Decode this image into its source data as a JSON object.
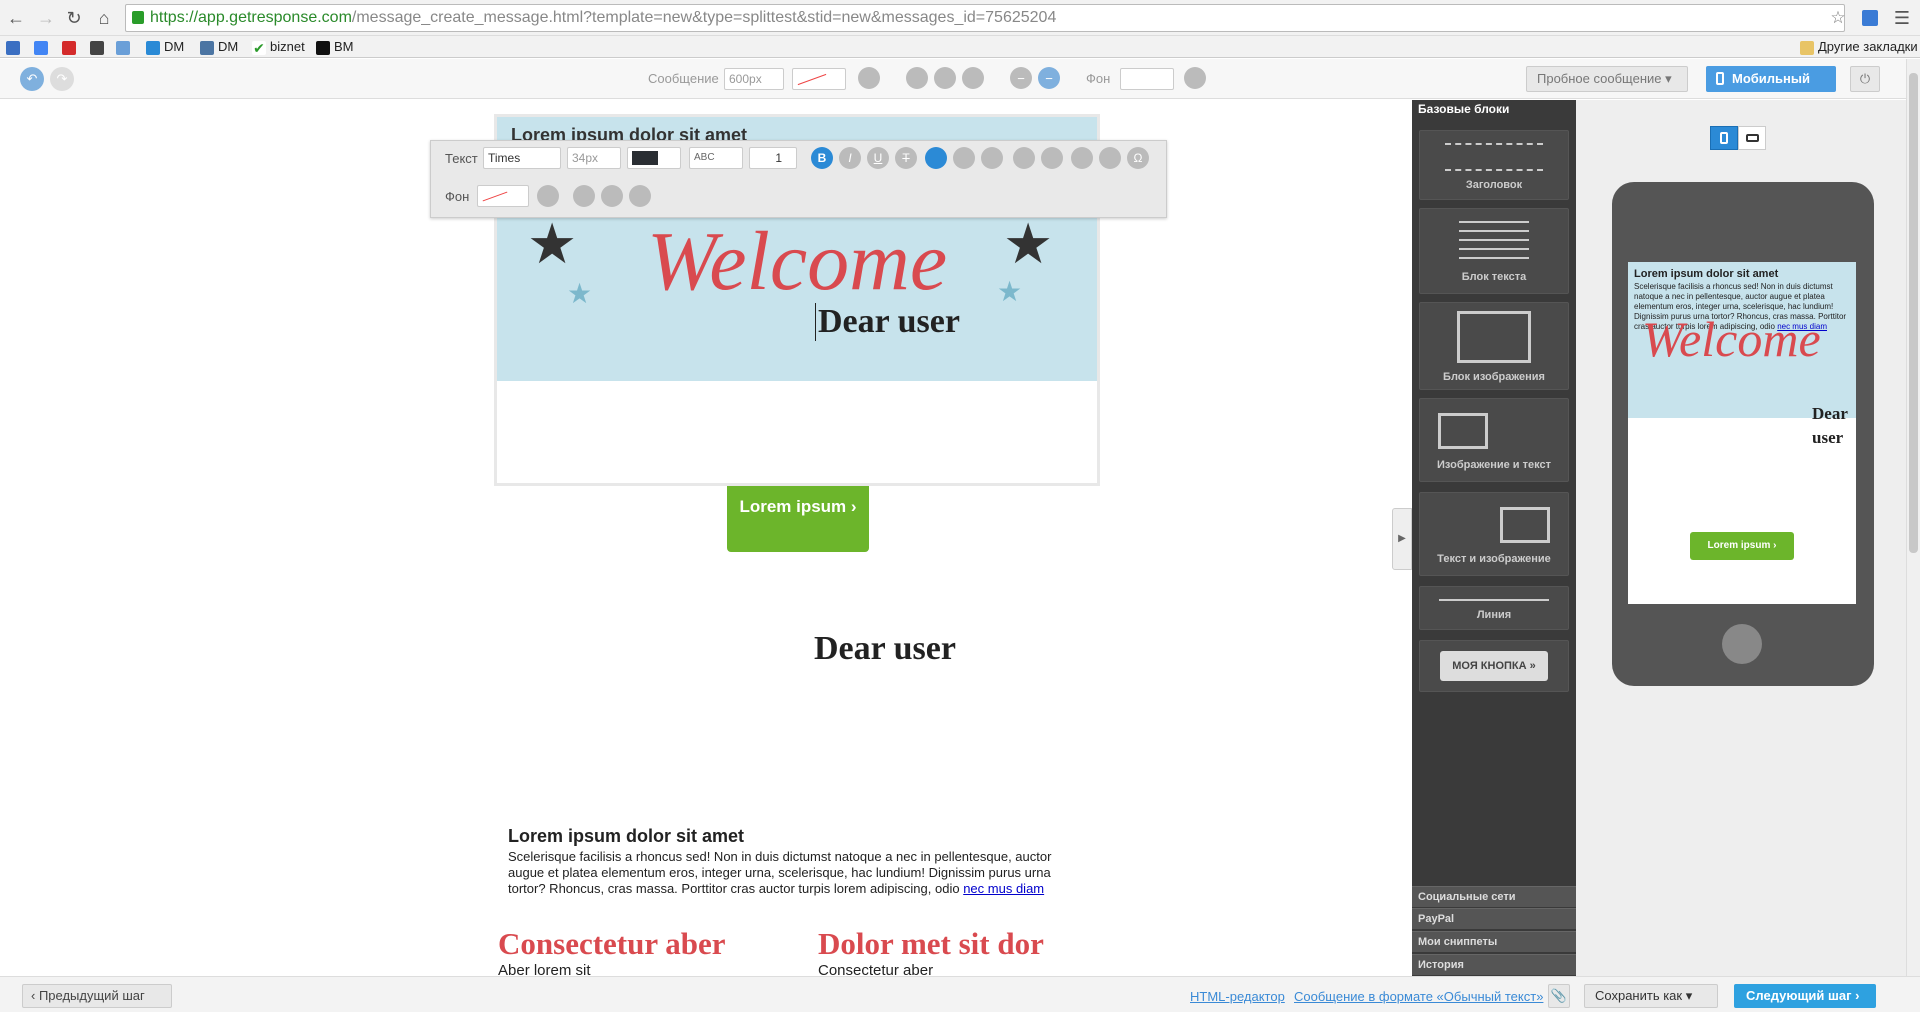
{
  "browser": {
    "url_host": "https://app.getresponse.com",
    "url_path": "/message_create_message.html?template=new&type=splittest&stid=new&messages_id=75625204",
    "bookmarks": [
      "DM",
      "DM",
      "biznet",
      "BM"
    ],
    "other_bookmarks": "Другие закладки"
  },
  "toolbar": {
    "message_label": "Сообщение",
    "width_value": "600px",
    "bg_label": "Фон",
    "test_message": "Пробное сообщение",
    "mobile_button": "Мобильный"
  },
  "text_toolbar": {
    "text_label": "Текст",
    "font": "Times",
    "size": "34px",
    "line_height": "1",
    "bg_label": "Фон"
  },
  "email": {
    "header_title": "Lorem ipsum dolor sit amet",
    "welcome": "Welcome",
    "dear_user": "Dear user",
    "button_label": "Lorem ipsum ›",
    "dear_user_2": "Dear user",
    "para_title": "Lorem ipsum dolor sit amet",
    "para_text": "Scelerisque facilisis a rhoncus sed! Non in duis dictumst natoque a nec in pellentesque, auctor augue et platea elementum eros, integer urna, scelerisque, hac lundium! Dignissim purus urna tortor? Rhoncus, cras massa. Porttitor cras auctor turpis lorem adipiscing, odio",
    "para_link": "nec mus diam",
    "col1_title": "Consectetur aber",
    "col1_text": "Aber lorem sit",
    "col2_title": "Dolor met sit dor",
    "col2_text": "Consectetur aber"
  },
  "sidebar": {
    "title": "Базовые блоки",
    "blocks": [
      "Заголовок",
      "Блок текста",
      "Блок изображения",
      "Изображение и текст",
      "Текст и изображение",
      "Линия"
    ],
    "my_button": "МОЯ КНОПКА »",
    "accordions": [
      "Социальные сети",
      "PayPal",
      "Мои сниппеты",
      "История"
    ]
  },
  "preview": {
    "title": "Lorem ipsum dolor sit amet",
    "text": "Scelerisque facilisis a rhoncus sed! Non in duis dictumst natoque a nec in pellentesque, auctor augue et platea elementum eros, integer urna, scelerisque, hac lundium! Dignissim purus urna tortor? Rhoncus, cras massa. Porttitor cras auctor turpis lorem adipiscing, odio",
    "link": "nec mus diam",
    "welcome": "Welcome",
    "dear_user": "Dear user",
    "button": "Lorem ipsum ›"
  },
  "bottom": {
    "prev_step": "Предыдущий шаг",
    "html_editor": "HTML-редактор",
    "plain_text": "Сообщение в формате «Обычный текст»",
    "save_as": "Сохранить как",
    "next_step": "Следующий шаг"
  }
}
